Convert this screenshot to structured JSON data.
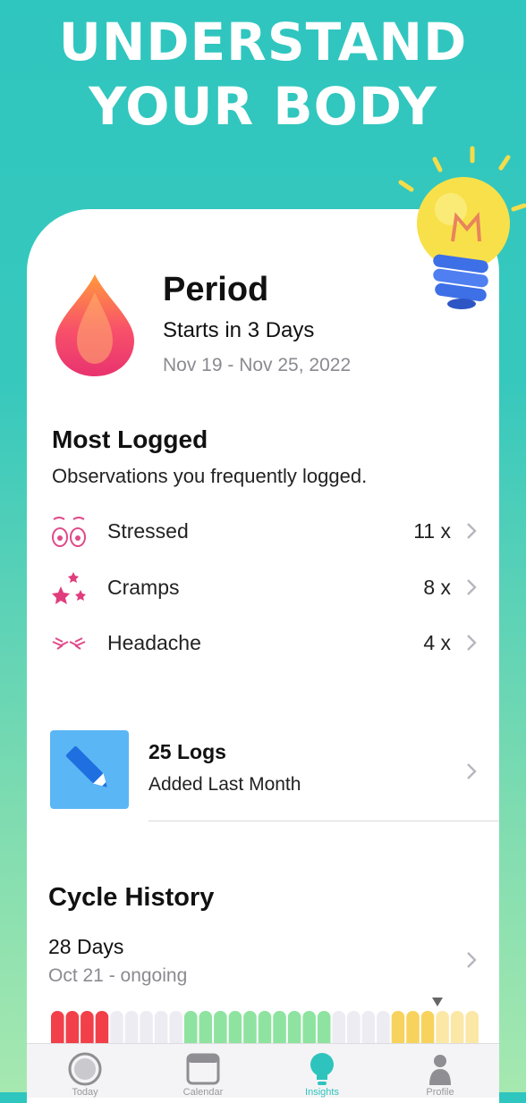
{
  "headline": {
    "line1": "UNDERSTAND",
    "line2": "YOUR BODY"
  },
  "period": {
    "icon": "blood-drop-icon",
    "title": "Period",
    "subtitle": "Starts in 3 Days",
    "dates": "Nov 19 - Nov 25, 2022"
  },
  "most_logged": {
    "title": "Most Logged",
    "description": "Observations you frequently logged.",
    "items": [
      {
        "icon": "stressed-face-icon",
        "label": "Stressed",
        "count": "11 x"
      },
      {
        "icon": "cramps-stars-icon",
        "label": "Cramps",
        "count": "8 x"
      },
      {
        "icon": "headache-icon",
        "label": "Headache",
        "count": "4 x"
      }
    ]
  },
  "logs": {
    "icon": "pencil-icon",
    "title": "25 Logs",
    "subtitle": "Added Last Month"
  },
  "cycle_history": {
    "title": "Cycle History",
    "days": "28 Days",
    "range": "Oct 21 - ongoing",
    "segments": [
      "period",
      "period",
      "period",
      "period",
      "none",
      "none",
      "none",
      "none",
      "none",
      "fertile",
      "fertile",
      "fertile",
      "fertile",
      "fertile",
      "fertile",
      "fertile",
      "fertile",
      "fertile",
      "fertile",
      "none",
      "none",
      "none",
      "none",
      "ovulation",
      "ovulation",
      "ovulation",
      "ovulation-light",
      "ovulation-light",
      "ovulation-light"
    ],
    "current_day_index": 25,
    "colors": {
      "period": "#f2404a",
      "fertile": "#8fe3a0",
      "none": "#ececf2",
      "ovulation": "#f7d35e",
      "ovulation-light": "#fbe8a6"
    }
  },
  "tab_bar": {
    "tabs": [
      {
        "icon": "today-circle-icon",
        "label": "Today",
        "active": false
      },
      {
        "icon": "calendar-icon",
        "label": "Calendar",
        "active": false
      },
      {
        "icon": "insights-bulb-icon",
        "label": "Insights",
        "active": true
      },
      {
        "icon": "profile-icon",
        "label": "Profile",
        "active": false
      }
    ]
  },
  "colors": {
    "accent": "#2ec4bd",
    "inactive": "#8e8e93"
  }
}
